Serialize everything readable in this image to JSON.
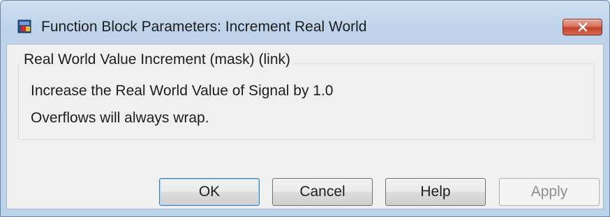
{
  "window": {
    "title": "Function Block Parameters: Increment Real World"
  },
  "group": {
    "legend": "Real World Value Increment (mask) (link)",
    "description_lines": [
      "Increase the Real World Value of Signal by 1.0",
      "Overflows will always wrap."
    ]
  },
  "buttons": {
    "ok": "OK",
    "cancel": "Cancel",
    "help": "Help",
    "apply": "Apply"
  },
  "icons": {
    "app": "simulink-block-icon",
    "close": "close-x-icon"
  },
  "colors": {
    "close_button": "#c4412c",
    "dialog_bg": "#f0f0f0",
    "frame_bg": "#bcd2e9"
  }
}
